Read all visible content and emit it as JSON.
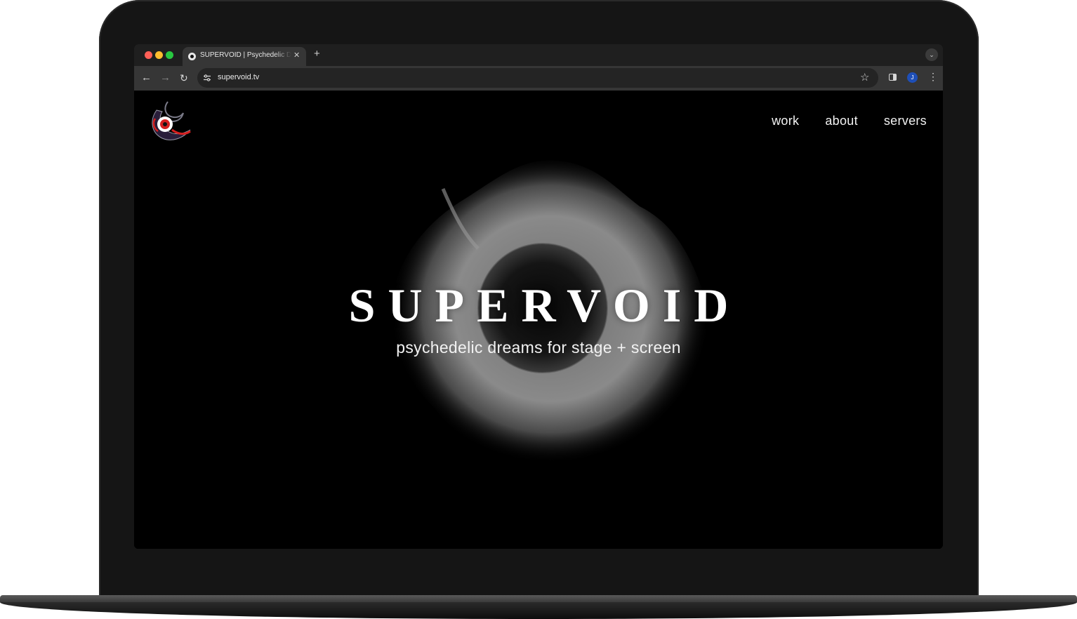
{
  "browser": {
    "tab_title": "SUPERVOID | Psychedelic Dreams for Stage + Screen",
    "url": "supervoid.tv",
    "profile_initial": "J",
    "traffic_light_colors": [
      "#ff5f57",
      "#febc2e",
      "#28c840"
    ],
    "icons": {
      "back": "back-arrow-icon",
      "forward": "forward-arrow-icon",
      "reload": "reload-icon",
      "bookmark": "star-icon",
      "side_panel": "side-panel-icon",
      "menu": "kebab-menu-icon"
    }
  },
  "site": {
    "nav": [
      {
        "label": "work"
      },
      {
        "label": "about"
      },
      {
        "label": "servers"
      }
    ],
    "hero": {
      "title": "SUPERVOID",
      "tagline": "psychedelic dreams for stage + screen"
    },
    "colors": {
      "background": "#000000",
      "text": "#f2f2f2",
      "logo_accent": "#d61f1f"
    }
  }
}
